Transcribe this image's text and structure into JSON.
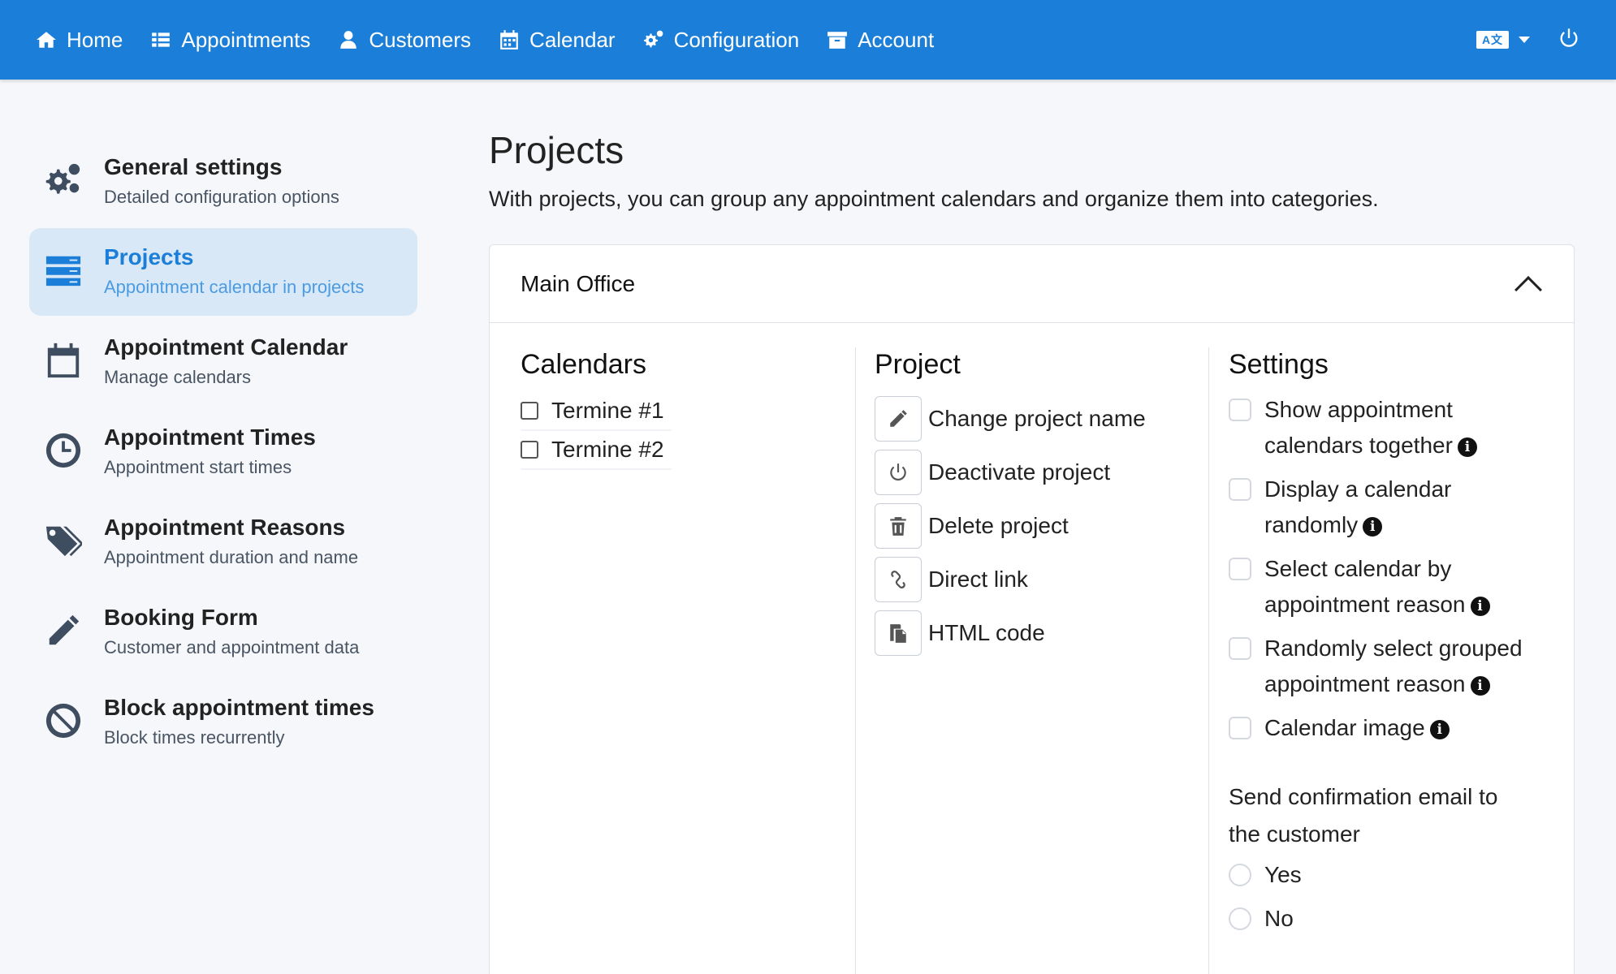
{
  "nav": {
    "items": [
      {
        "label": "Home",
        "icon": "home-icon"
      },
      {
        "label": "Appointments",
        "icon": "list-icon"
      },
      {
        "label": "Customers",
        "icon": "user-icon"
      },
      {
        "label": "Calendar",
        "icon": "calendar-icon"
      },
      {
        "label": "Configuration",
        "icon": "gears-icon"
      },
      {
        "label": "Account",
        "icon": "archive-icon"
      }
    ],
    "language_icon": "language-icon",
    "power_icon": "power-icon"
  },
  "sidebar": {
    "items": [
      {
        "title": "General settings",
        "subtitle": "Detailed configuration options",
        "icon": "gears-icon"
      },
      {
        "title": "Projects",
        "subtitle": "Appointment calendar in projects",
        "icon": "server-icon",
        "active": true
      },
      {
        "title": "Appointment Calendar",
        "subtitle": "Manage calendars",
        "icon": "calendar-icon"
      },
      {
        "title": "Appointment Times",
        "subtitle": "Appointment start times",
        "icon": "clock-icon"
      },
      {
        "title": "Appointment Reasons",
        "subtitle": "Appointment duration and name",
        "icon": "tags-icon"
      },
      {
        "title": "Booking Form",
        "subtitle": "Customer and appointment data",
        "icon": "pencil-icon"
      },
      {
        "title": "Block appointment times",
        "subtitle": "Block times recurrently",
        "icon": "ban-icon"
      }
    ]
  },
  "main": {
    "title": "Projects",
    "description": "With projects, you can group any appointment calendars and organize them into categories.",
    "card": {
      "name": "Main Office",
      "calendars": {
        "heading": "Calendars",
        "items": [
          "Termine #1",
          "Termine #2"
        ]
      },
      "project": {
        "heading": "Project",
        "actions": [
          {
            "label": "Change project name",
            "icon": "pencil-icon"
          },
          {
            "label": "Deactivate project",
            "icon": "power-icon"
          },
          {
            "label": "Delete project",
            "icon": "trash-icon"
          },
          {
            "label": "Direct link",
            "icon": "link-icon"
          },
          {
            "label": "HTML code",
            "icon": "copy-icon"
          }
        ]
      },
      "settings": {
        "heading": "Settings",
        "options": [
          {
            "line1": "Show appointment",
            "line2": "calendars together"
          },
          {
            "line1": "Display a calendar",
            "line2": "randomly"
          },
          {
            "line1": "Select calendar by",
            "line2": "appointment reason"
          },
          {
            "line1": "Randomly select grouped",
            "line2": "appointment reason"
          },
          {
            "line1": "Calendar image",
            "line2": ""
          }
        ],
        "confirm_line1": "Send confirmation email to",
        "confirm_line2": "the customer",
        "radio_yes": "Yes",
        "radio_no": "No"
      }
    }
  },
  "colors": {
    "primary": "#1b7fd9",
    "active_bg": "#d9e8f6"
  }
}
